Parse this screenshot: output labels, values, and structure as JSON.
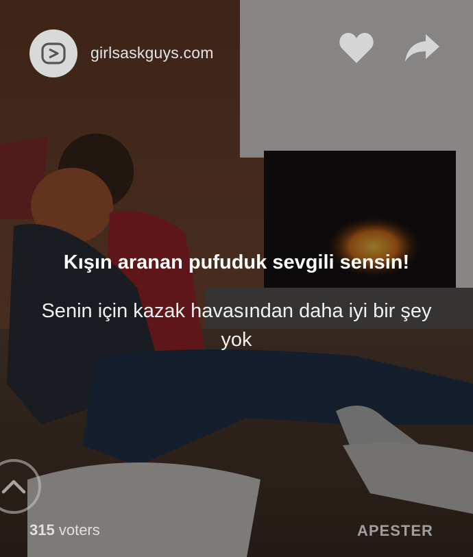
{
  "header": {
    "site_name": "girlsaskguys.com",
    "logo_icon": "girlsaskguys-logo-icon",
    "like_icon": "heart-icon",
    "share_icon": "share-arrow-icon"
  },
  "content": {
    "title": "Kışın aranan pufuduk sevgili sensin!",
    "subtitle": "Senin için kazak havasından daha iyi bir şey yok"
  },
  "footer": {
    "voters_count": "315",
    "voters_label": "voters",
    "brand": "APESTER",
    "scroll_up_icon": "chevron-up-icon"
  },
  "colors": {
    "overlay": "#000000",
    "text": "#ffffff",
    "logo_bg": "#d9d9d9"
  }
}
